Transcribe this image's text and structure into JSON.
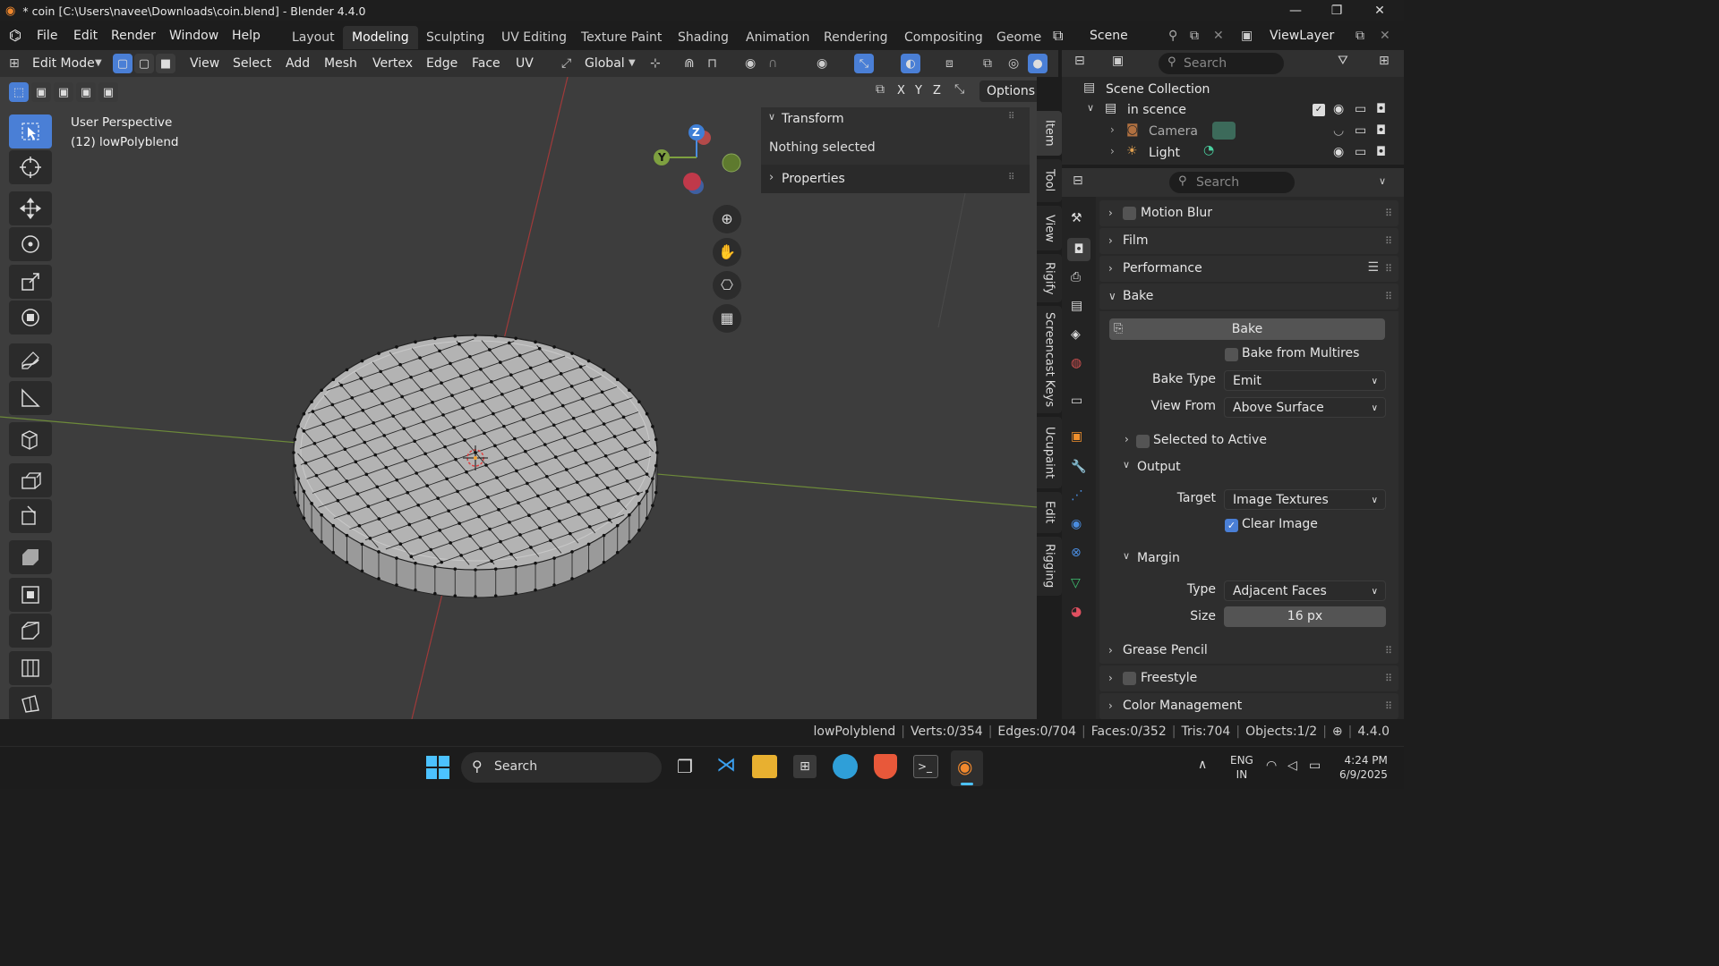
{
  "window": {
    "title": "* coin [C:\\Users\\navee\\Downloads\\coin.blend] - Blender 4.4.0",
    "minimize": "—",
    "maximize": "❐",
    "close": "✕"
  },
  "menu": {
    "file": "File",
    "edit": "Edit",
    "render": "Render",
    "window": "Window",
    "help": "Help"
  },
  "workspaces": [
    "Layout",
    "Modeling",
    "Sculpting",
    "UV Editing",
    "Texture Paint",
    "Shading",
    "Animation",
    "Rendering",
    "Compositing",
    "Geome"
  ],
  "active_workspace": "Modeling",
  "scene": {
    "name": "Scene",
    "view_layer": "ViewLayer"
  },
  "header": {
    "mode": "Edit Mode",
    "view": "View",
    "select": "Select",
    "add": "Add",
    "mesh": "Mesh",
    "vertex": "Vertex",
    "edge": "Edge",
    "face": "Face",
    "uv": "UV",
    "orientation": "Global"
  },
  "viewport_sub": {
    "x": "X",
    "y": "Y",
    "z": "Z",
    "options": "Options"
  },
  "viewport": {
    "perspective": "User Perspective",
    "object": "(12) lowPolyblend"
  },
  "gizmo": {
    "z": "Z",
    "y": "Y"
  },
  "npanel": {
    "transform": "Transform",
    "nothing_selected": "Nothing selected",
    "properties": "Properties"
  },
  "side_tabs": [
    "Item",
    "Tool",
    "View",
    "Rigify",
    "Screencast Keys",
    "Ucupaint",
    "Edit",
    "Rigging"
  ],
  "outliner": {
    "search_placeholder": "Search",
    "scene_collection": "Scene Collection",
    "collection": "in scence",
    "items": [
      "Camera",
      "Light"
    ]
  },
  "properties": {
    "search_placeholder": "Search",
    "motion_blur": "Motion Blur",
    "film": "Film",
    "performance": "Performance",
    "bake": "Bake",
    "bake_button": "Bake",
    "bake_from_multires": "Bake from Multires",
    "bake_type_label": "Bake Type",
    "bake_type": "Emit",
    "view_from_label": "View From",
    "view_from": "Above Surface",
    "selected_to_active": "Selected to Active",
    "output": "Output",
    "target_label": "Target",
    "target": "Image Textures",
    "clear_image": "Clear Image",
    "margin": "Margin",
    "type_label": "Type",
    "type": "Adjacent Faces",
    "size_label": "Size",
    "size": "16 px",
    "grease_pencil": "Grease Pencil",
    "freestyle": "Freestyle",
    "color_management": "Color Management"
  },
  "statusbar": {
    "object": "lowPolyblend",
    "verts": "Verts:0/354",
    "edges": "Edges:0/704",
    "faces": "Faces:0/352",
    "tris": "Tris:704",
    "objects": "Objects:1/2",
    "version": "4.4.0"
  },
  "taskbar": {
    "search": "Search",
    "lang1": "ENG",
    "lang2": "IN",
    "time": "4:24 PM",
    "date": "6/9/2025"
  },
  "colors": {
    "accent": "#4a7fd6",
    "viewport_bg": "#3d3d3d",
    "panel_bg": "#282828",
    "x_axis": "#b34a4a",
    "y_axis": "#7ea040"
  }
}
